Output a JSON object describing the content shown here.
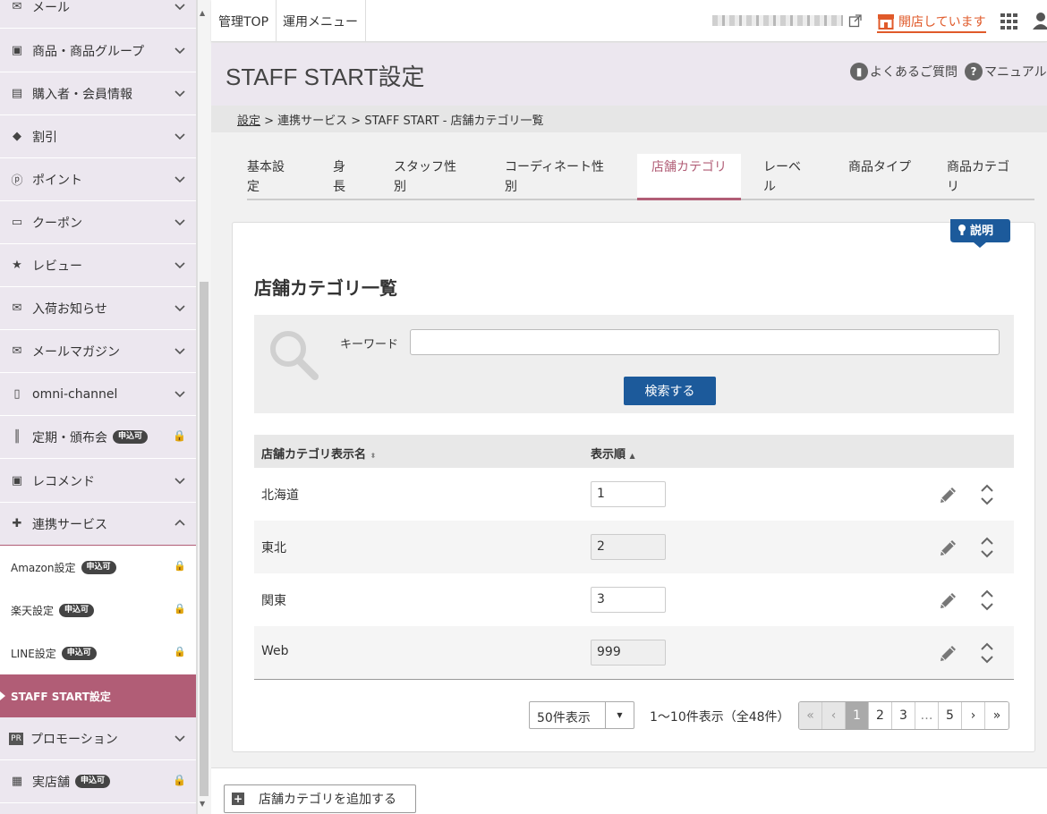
{
  "sidebar": {
    "items": [
      {
        "label": "メール",
        "icon": "mail-icon"
      },
      {
        "label": "商品・商品グループ",
        "icon": "product-icon"
      },
      {
        "label": "購入者・会員情報",
        "icon": "member-card-icon"
      },
      {
        "label": "割引",
        "icon": "tag-icon"
      },
      {
        "label": "ポイント",
        "icon": "point-icon"
      },
      {
        "label": "クーポン",
        "icon": "coupon-icon"
      },
      {
        "label": "レビュー",
        "icon": "review-icon"
      },
      {
        "label": "入荷お知らせ",
        "icon": "arrival-mail-icon"
      },
      {
        "label": "メールマガジン",
        "icon": "newsletter-icon"
      },
      {
        "label": "omni-channel",
        "icon": "mobile-icon"
      },
      {
        "label": "定期・頒布会",
        "icon": "barcode-icon",
        "badge": "申込可",
        "locked": true
      },
      {
        "label": "レコメンド",
        "icon": "recommend-icon"
      },
      {
        "label": "連携サービス",
        "icon": "puzzle-icon",
        "expanded": true
      }
    ],
    "subitems": [
      {
        "label": "Amazon設定",
        "badge": "申込可"
      },
      {
        "label": "楽天設定",
        "badge": "申込可"
      },
      {
        "label": "LINE設定",
        "badge": "申込可"
      }
    ],
    "active_item": "STAFF START設定",
    "bottom_items": [
      {
        "label": "プロモーション",
        "icon": "pr-icon"
      },
      {
        "label": "実店舗",
        "icon": "store-icon",
        "badge": "申込可",
        "locked": true
      }
    ]
  },
  "topbar": {
    "admin_top": "管理TOP",
    "ops_menu": "運用メニュー",
    "store_status": "開店しています"
  },
  "header": {
    "title": "STAFF START設定",
    "faq": "よくあるご質問",
    "manual": "マニュアル"
  },
  "breadcrumb": {
    "root": "設定",
    "rest": " > 連携サービス > STAFF START - 店舗カテゴリ一覧"
  },
  "tabs": [
    {
      "label": "基本設定"
    },
    {
      "label": "身長"
    },
    {
      "label": "スタッフ性別"
    },
    {
      "label": "コーディネート性別"
    },
    {
      "label": "店舗カテゴリ",
      "active": true
    },
    {
      "label": "レーベル"
    },
    {
      "label": "商品タイプ"
    },
    {
      "label": "商品カテゴリ"
    }
  ],
  "explain_label": "説明",
  "section_title": "店舗カテゴリ一覧",
  "search": {
    "keyword_label": "キーワード",
    "keyword_value": "",
    "button": "検索する"
  },
  "table": {
    "headers": [
      "店舗カテゴリ表示名",
      "表示順"
    ],
    "rows": [
      {
        "name": "北海道",
        "order": "1"
      },
      {
        "name": "東北",
        "order": "2"
      },
      {
        "name": "関東",
        "order": "3"
      },
      {
        "name": "Web",
        "order": "999"
      }
    ]
  },
  "pagination": {
    "per_page": "50件表示",
    "summary": "1〜10件表示（全48件）",
    "pages": [
      "1",
      "2",
      "3",
      "…",
      "5"
    ],
    "current_page": "1"
  },
  "add_button": "店舗カテゴリを追加する",
  "colors": {
    "accent": "#b15d76",
    "primary_button": "#1c5a9b",
    "store_status": "#e05a2a",
    "sidebar_bg": "#ece7ef"
  }
}
